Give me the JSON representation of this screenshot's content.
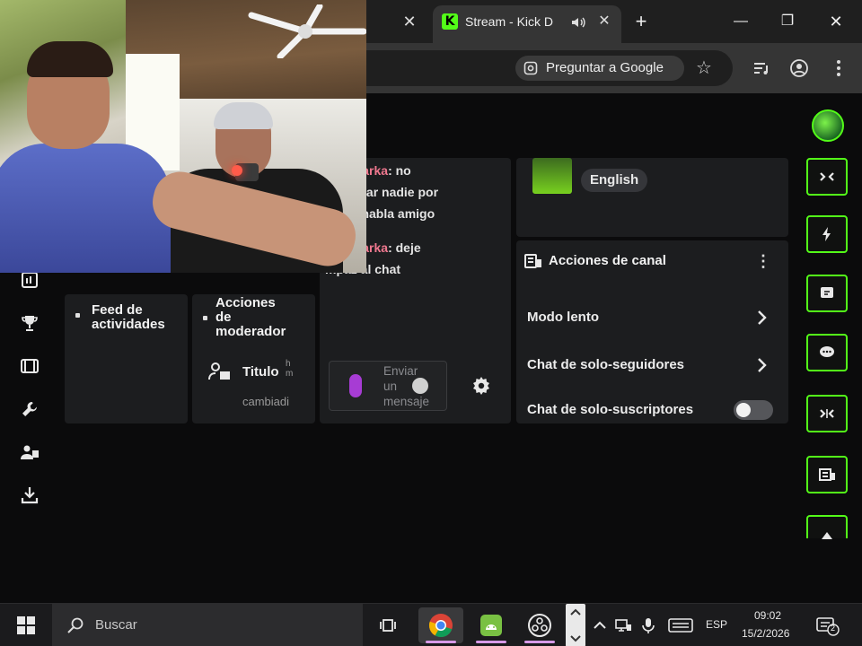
{
  "browser": {
    "active_tab_title": "Stream - Kick D",
    "ask_google_label": "Preguntar a Google"
  },
  "channel_info": {
    "language": "English"
  },
  "channel_actions": {
    "title": "Acciones de canal",
    "slow_mode": "Modo lento",
    "followers_only": "Chat de solo-seguidores",
    "subscribers_only": "Chat de solo-suscriptores",
    "subscribers_only_enabled": false
  },
  "chat": {
    "messages": [
      {
        "user": "egarciarka",
        "text": "no",
        "cont": [
          "re habiar nadie por",
          "nadie habla amigo"
        ]
      },
      {
        "user": "egarciarka",
        "text": "deje",
        "cont": [
          "mpaz al chat"
        ]
      }
    ],
    "input_placeholder": [
      "Enviar",
      "un",
      "mensaje"
    ]
  },
  "activity_feed": {
    "title_lines": [
      "Feed de",
      "actividades"
    ]
  },
  "mod_actions": {
    "title_lines": [
      "Acciones",
      "de",
      "moderador"
    ],
    "item_title": "Titulo",
    "item_time_lines": [
      "h",
      "m"
    ],
    "item_subtitle": "cambiadi"
  },
  "taskbar": {
    "search_label": "Buscar",
    "language": "ESP",
    "time": "09:02",
    "date": "15/2/2026",
    "notification_count": "2"
  },
  "colors": {
    "kick_green": "#53fc18",
    "chat_username": "#f0788f",
    "panel_bg": "#1c1d1f"
  }
}
